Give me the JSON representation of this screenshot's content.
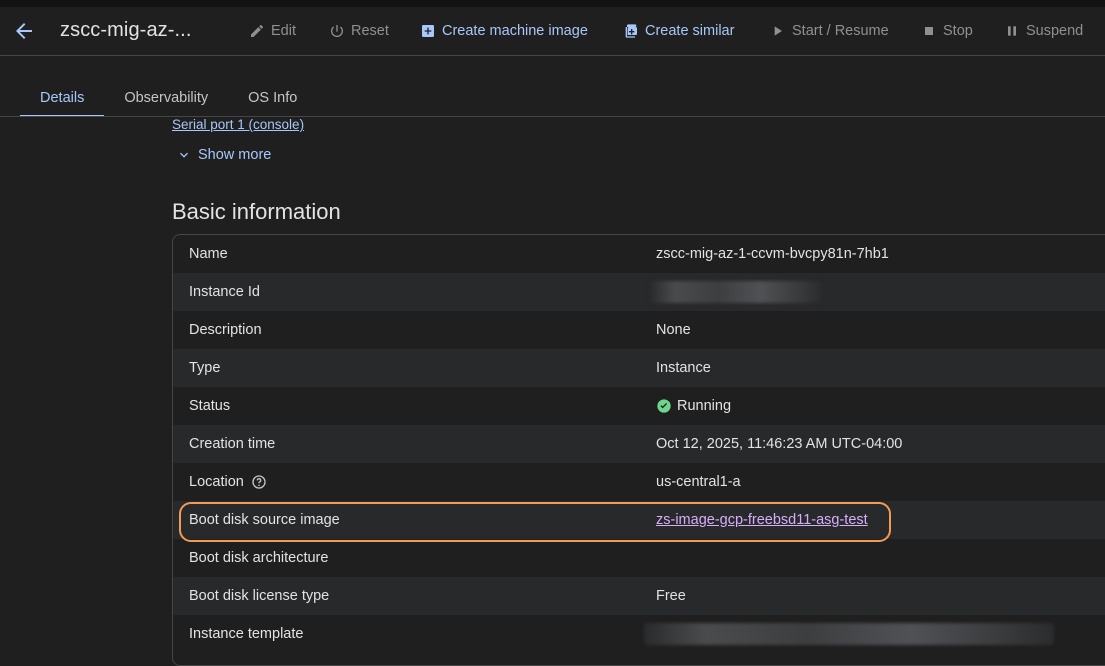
{
  "header": {
    "title": "zscc-mig-az-...",
    "actions": {
      "edit": "Edit",
      "reset": "Reset",
      "create_machine_image": "Create machine image",
      "create_similar": "Create similar",
      "start_resume": "Start / Resume",
      "stop": "Stop",
      "suspend": "Suspend"
    }
  },
  "tabs": [
    {
      "label": "Details",
      "active": true
    },
    {
      "label": "Observability",
      "active": false
    },
    {
      "label": "OS Info",
      "active": false
    }
  ],
  "links": {
    "serial_port": "Serial port 1 (console)",
    "show_more": "Show more"
  },
  "basic_info": {
    "title": "Basic information",
    "rows": [
      {
        "label": "Name",
        "value": "zscc-mig-az-1-ccvm-bvcpy81n-7hb1"
      },
      {
        "label": "Instance Id",
        "value": ""
      },
      {
        "label": "Description",
        "value": "None"
      },
      {
        "label": "Type",
        "value": "Instance"
      },
      {
        "label": "Status",
        "value": "Running"
      },
      {
        "label": "Creation time",
        "value": "Oct 12, 2025, 11:46:23 AM UTC-04:00"
      },
      {
        "label": "Location",
        "value": "us-central1-a"
      },
      {
        "label": "Boot disk source image",
        "value": "zs-image-gcp-freebsd11-asg-test"
      },
      {
        "label": "Boot disk architecture",
        "value": ""
      },
      {
        "label": "Boot disk license type",
        "value": "Free"
      },
      {
        "label": "Instance template",
        "value": ""
      }
    ]
  },
  "colors": {
    "background": "#1f1f1f",
    "accent": "#a8c7fa",
    "link_visited": "#d7aefb",
    "status_ok": "#6dd58c",
    "highlight": "#f29a57"
  },
  "icons": [
    "back-arrow-icon",
    "pencil-icon",
    "power-icon",
    "add-box-icon",
    "add-copy-icon",
    "play-icon",
    "stop-icon",
    "pause-icon",
    "chevron-down-icon",
    "check-circle-icon",
    "help-circle-icon"
  ]
}
